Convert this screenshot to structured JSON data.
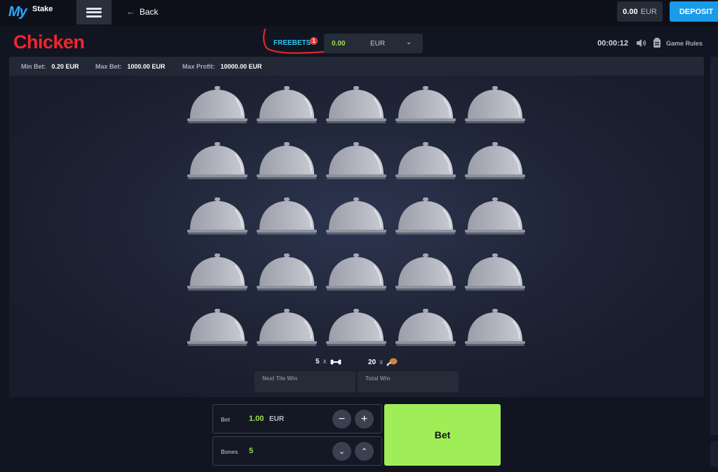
{
  "header": {
    "logo_my": "My",
    "logo_stake": "Stake",
    "back_label": "Back",
    "balance_amount": "0.00",
    "balance_currency": "EUR",
    "deposit_label": "DEPOSIT"
  },
  "game": {
    "title": "Chicken",
    "freebets_label": "FREEBETS",
    "freebets_badge": "1",
    "freebet_amount": "0.00",
    "freebet_currency": "EUR",
    "timer": "00:00:12",
    "rules_label": "Game Rules"
  },
  "limits": {
    "min_bet_label": "Min Bet:",
    "min_bet_value": "0.20 EUR",
    "max_bet_label": "Max Bet:",
    "max_bet_value": "1000.00 EUR",
    "max_profit_label": "Max Profit:",
    "max_profit_value": "10000.00 EUR"
  },
  "board": {
    "rows": 5,
    "cols": 5,
    "bones_count": "5",
    "chicken_count": "20",
    "next_tile_win_label": "Next Tile Win",
    "total_win_label": "Total Win"
  },
  "controls": {
    "bet_label": "Bet",
    "bet_value": "1.00",
    "bet_currency": "EUR",
    "bones_label": "Bones",
    "bones_value": "5",
    "bet_button_label": "Bet"
  },
  "colors": {
    "title_red": "#f0262d",
    "accent_green": "#a0ee57",
    "deposit_blue": "#1a9bea",
    "freebets_cyan": "#2bc8f0"
  }
}
